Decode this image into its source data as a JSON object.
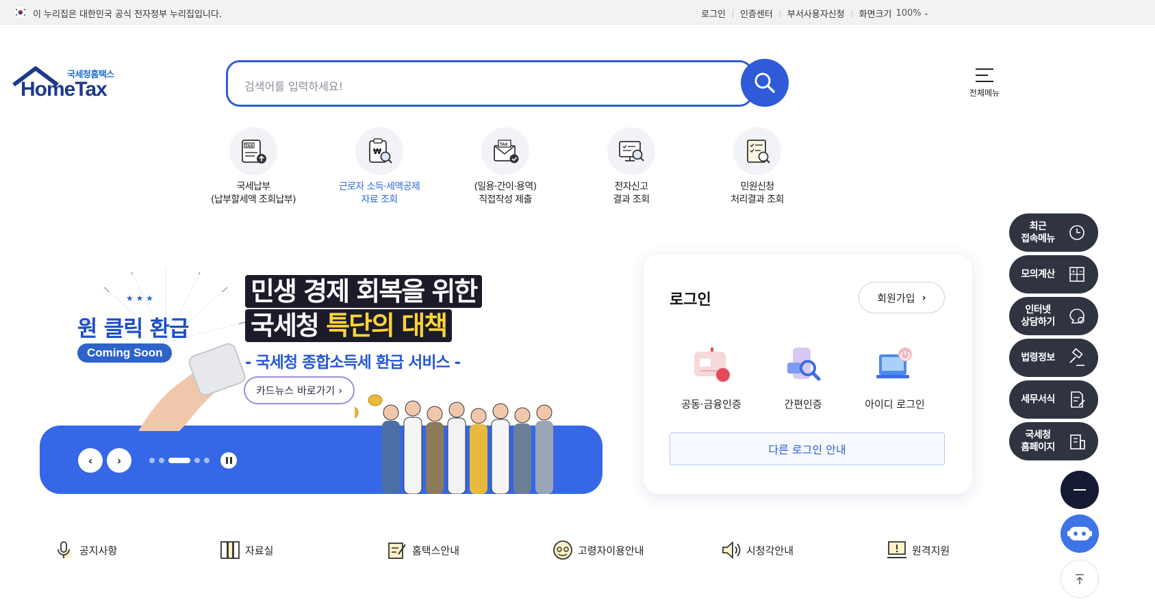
{
  "gov_bar": {
    "notice": "이 누리집은 대한민국 공식 전자정부 누리집입니다.",
    "links": [
      "로그인",
      "인증센터",
      "부서사용자신청"
    ],
    "zoom_label": "화면크기",
    "zoom_value": "100%"
  },
  "header": {
    "logo_sub": "국세청홈택스",
    "logo_main": "HomeTax",
    "search_placeholder": "검색어를 입력하세요!",
    "all_menu_label": "전체메뉴"
  },
  "quick_services": [
    {
      "line1": "국세납부",
      "line2": "(납부할세액 조회납부)",
      "icon": "tax-payment-icon"
    },
    {
      "line1": "근로자 소득·세액공제",
      "line2": "자료 조회",
      "icon": "income-deduction-icon",
      "active": true
    },
    {
      "line1": "(일용·간이·용역)",
      "line2": "직접작성 제출",
      "icon": "direct-submit-icon"
    },
    {
      "line1": "전자신고",
      "line2": "결과 조회",
      "icon": "e-filing-result-icon"
    },
    {
      "line1": "민원신청",
      "line2": "처리결과 조회",
      "icon": "civil-result-icon"
    }
  ],
  "banner": {
    "oneclick_title": "원 클릭 환급",
    "oneclick_badge": "Coming Soon",
    "headline_1": "민생 경제 회복을 위한",
    "headline_2a": "국세청 ",
    "headline_2b": "특단의 대책",
    "subline": "- 국세청 종합소득세 환급 서비스 -",
    "cardnews_button": "카드뉴스 바로가기",
    "active_slide": 3,
    "total_slides": 5
  },
  "login_panel": {
    "title": "로그인",
    "join_button": "회원가입",
    "options": [
      {
        "label": "공동·금융인증",
        "icon": "certificate-icon"
      },
      {
        "label": "간편인증",
        "icon": "simple-auth-icon"
      },
      {
        "label": "아이디 로그인",
        "icon": "id-login-icon"
      }
    ],
    "other_login": "다른 로그인 안내"
  },
  "bottom_links": [
    {
      "label": "공지사항",
      "icon": "microphone-icon"
    },
    {
      "label": "자료실",
      "icon": "archive-icon"
    },
    {
      "label": "홈택스안내",
      "icon": "guide-icon"
    },
    {
      "label": "고령자이용안내",
      "icon": "senior-icon"
    },
    {
      "label": "시청각안내",
      "icon": "speaker-icon"
    },
    {
      "label": "원격지원",
      "icon": "remote-support-icon"
    }
  ],
  "floating_menu": [
    {
      "line1": "최근",
      "line2": "접속메뉴",
      "icon": "clock-icon"
    },
    {
      "line1": "모의계산",
      "line2": "",
      "icon": "calculator-icon"
    },
    {
      "line1": "인터넷",
      "line2": "상담하기",
      "icon": "chat-icon"
    },
    {
      "line1": "법령정보",
      "line2": "",
      "icon": "gavel-icon"
    },
    {
      "line1": "세무서식",
      "line2": "",
      "icon": "form-icon"
    },
    {
      "line1": "국세청",
      "line2": "홈페이지",
      "icon": "building-icon"
    }
  ],
  "colors": {
    "brand_blue": "#2f5bd8",
    "banner_blue": "#3567e6",
    "floating_dark": "#2f3440"
  }
}
